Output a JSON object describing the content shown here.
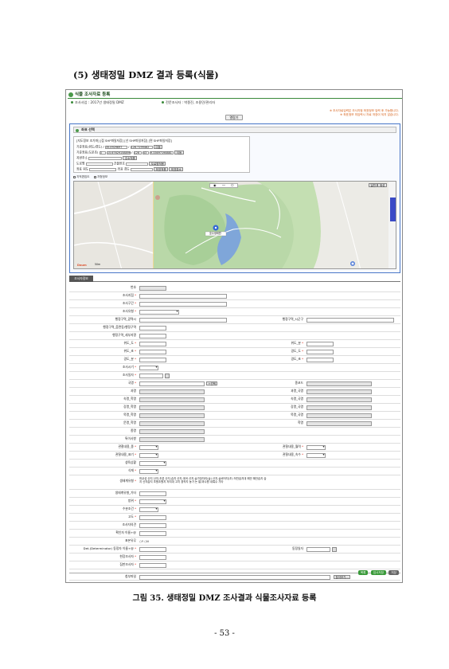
{
  "document": {
    "section_heading": "(5) 생태정밀 DMZ 결과 등록(식물)",
    "caption": "그림 35. 생태정밀 DMZ 조사결과 식물조사자료 등록",
    "page_number": "- 53 -"
  },
  "screen": {
    "title": "식물 조사자료 등록",
    "survey_project": "조사사업 : 2017년 생태정밀 DMZ",
    "survey_manager": "전문조사자 : 박종진, 조용민/관리자",
    "notice_line1": "※ 조사자료입력은 조사지점 좌표정보 입력 후 가능합니다.",
    "notice_line2": "※ 좌표정보 미입력시 자료 저장이 되지 않습니다.",
    "view_button": "열람기",
    "accent_color": "#3a8a3a",
    "panel_border_color": "#4a78c8"
  },
  "location": {
    "header": "좌표 선택",
    "file_options": "[지도정보 조가파] [점 SHP파일저장] [선 SHP파일저장] [면 SHP파일저장]",
    "start_label": "기준좌표(위도/경도)",
    "start_lat": "35.0929697",
    "start_lon": "126.7199462",
    "start_btn": "이동",
    "dms_label": "기준좌표(도분초)",
    "dms_deg": "3",
    "dms_min": "15.67629158899",
    "dms_sec": "126",
    "dms_deg2": "43",
    "dms_min2": "9.33697198881",
    "dms_btn": "이동",
    "addr_label": "지번주소",
    "addr_btn": "주소적용",
    "road_label": "도로명",
    "bldg_label": "건물번호",
    "road_btn": "도로명적용",
    "point_label": "좌표 위도",
    "point_lon_label": "좌표 경도",
    "apply_btn": "좌표적용",
    "cancel_btn": "좌표취소"
  },
  "map": {
    "toggle_cadastral": "지적편집도",
    "toggle_terrain": "지형정보",
    "view_basic": "일반",
    "view_satellite": "위성",
    "marker_label": "호수생태원",
    "brand": "Daum",
    "scale": "50m"
  },
  "tab": {
    "label": "조사자정보"
  },
  "form": {
    "labels": {
      "number": "번호",
      "survey_site": "조사지점",
      "survey_section": "조사구간",
      "survey_type": "조사유형",
      "admin_city_do": "행정구역_광역시",
      "admin_sigungu": "행정구역_시군구",
      "admin_eupmyeon": "행정구역_읍면동/행정구역",
      "admin_detail": "행정구역_세부지명",
      "lat_deg": "위도_도",
      "lat_min": "위도_분",
      "lat_sec": "위도_초",
      "lon_deg": "경도_도",
      "lon_min": "경도_분",
      "lon_sec": "경도_초",
      "survey_time": "조사시기",
      "survey_date": "조사일자",
      "species": "국명",
      "species_btn": "+선택",
      "code": "종코드",
      "family_ko": "과명",
      "family_sci": "과명_국명",
      "genus_ko": "속명_학명",
      "genus_sci": "속명_국명",
      "species_sci": "강명_학명",
      "species_sci2": "강명_국명",
      "order_ko": "목명_학명",
      "order_sci": "목명_국명",
      "phylum_ko": "문명_학명",
      "phylum_sci": "학명",
      "species_name": "종명",
      "special_notes": "특이사항",
      "env_type": "관찰내용_종",
      "env_count": "관찰내용_월력",
      "env_area": "관찰내용_표기",
      "env_num": "관찰내용_속수",
      "life_form": "생육상황",
      "habitat": "식재",
      "ecology_type": "생태계유형",
      "ecology_other": "생태계유형_기타",
      "direction": "방위",
      "observation": "수분조건",
      "altitude": "고도",
      "surveyor_note": "조사자의견",
      "photo_name": "확인자 이름+@",
      "specimen": "표본유무",
      "determiner": "Det.(Determinator) 동정자 이름+@",
      "determine_date": "동정일자",
      "field_surveyor": "현장조사자",
      "lab_surveyor": "집판조사자",
      "attachment": "첨부파일"
    },
    "specimen_yes": "Y",
    "specimen_no": "N",
    "ecology_options_line1": "하교성 산지 산지-초본 산지-습지 산지-계곡 산지-숲가장자리(숲) 산지-숲바닥지(초) 하천습지대 해안 해안습지 습",
    "ecology_options_line2": "지 산지습지 초원초원지 저지대 고지 경작지 농가 논 밭/과수원 내륙수 기타",
    "browse_button": "찾아보기..."
  },
  "actions": {
    "list": "목록",
    "save": "임시저장",
    "register": "저장"
  }
}
